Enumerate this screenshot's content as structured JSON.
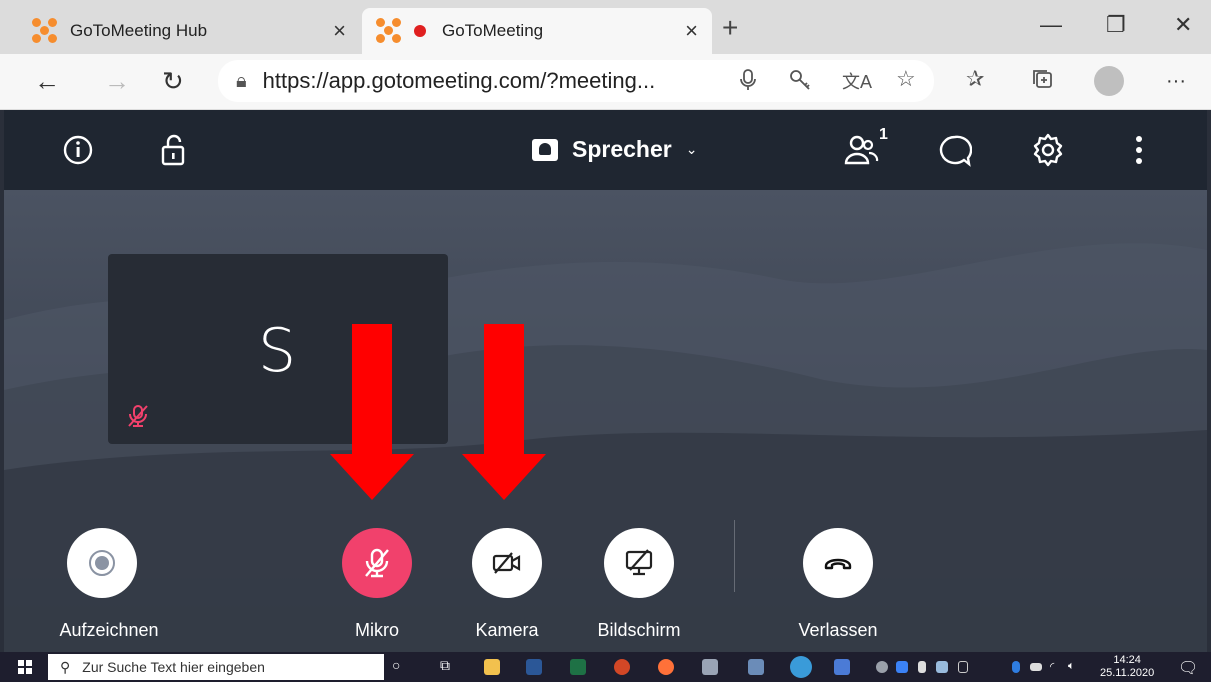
{
  "browser": {
    "tabs": [
      {
        "title": "GoToMeeting Hub",
        "close": "×"
      },
      {
        "title": "GoToMeeting",
        "close": "×"
      }
    ],
    "new_tab": "+",
    "window": {
      "minimize": "—",
      "restore": "❐",
      "close": "✕"
    },
    "nav": {
      "back": "←",
      "forward": "→",
      "reload": "↻"
    },
    "url": "https://app.gotomeeting.com/?meeting...",
    "more": "···"
  },
  "meeting": {
    "view_mode": "Sprecher",
    "participants_count": "1",
    "participant_initial": "S",
    "controls": [
      {
        "label": "Aufzeichnen"
      },
      {
        "label": "Mikro"
      },
      {
        "label": "Kamera"
      },
      {
        "label": "Bildschirm"
      },
      {
        "label": "Verlassen"
      }
    ],
    "colors": {
      "accent_red": "#f1416c",
      "arrow_red": "#ff0000",
      "toolbar_bg": "#1f2631"
    }
  },
  "taskbar": {
    "search_placeholder": "Zur Suche Text hier eingeben",
    "time": "14:24",
    "date": "25.11.2020"
  }
}
